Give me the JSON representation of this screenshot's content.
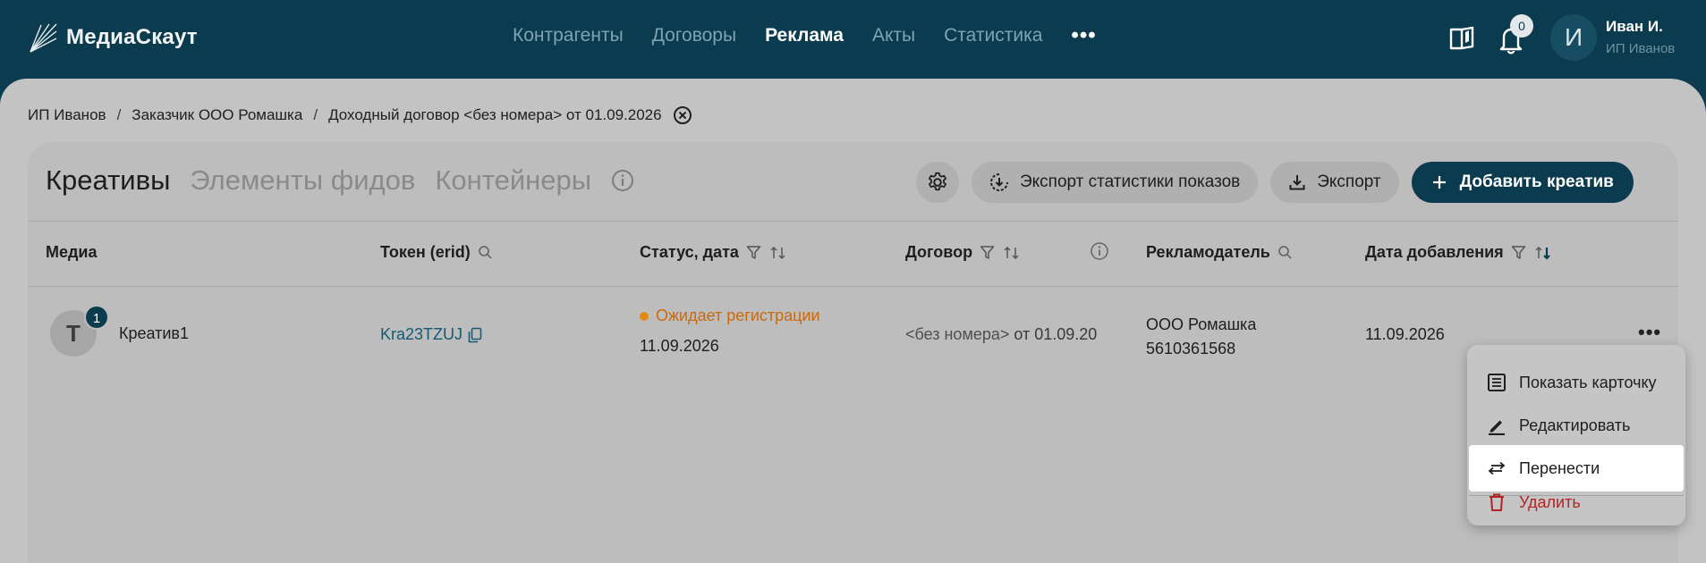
{
  "brand": {
    "name": "МедиаСкаут"
  },
  "nav": {
    "items": [
      {
        "label": "Контрагенты",
        "active": false
      },
      {
        "label": "Договоры",
        "active": false
      },
      {
        "label": "Реклама",
        "active": true
      },
      {
        "label": "Акты",
        "active": false
      },
      {
        "label": "Статистика",
        "active": false
      }
    ],
    "more_label": "•••"
  },
  "header": {
    "notifications_count": "0",
    "user_initial": "И",
    "user_name": "Иван И.",
    "user_org": "ИП Иванов"
  },
  "breadcrumb": {
    "items": [
      "ИП Иванов",
      "Заказчик ООО Ромашка",
      "Доходный договор <без номера> от 01.09.2026"
    ],
    "separator": "/"
  },
  "tabs": [
    {
      "label": "Креативы",
      "active": true
    },
    {
      "label": "Элементы фидов",
      "active": false
    },
    {
      "label": "Контейнеры",
      "active": false
    }
  ],
  "actions": {
    "export_stats_label": "Экспорт статистики показов",
    "export_label": "Экспорт",
    "add_label": "Добавить креатив"
  },
  "table": {
    "columns": [
      "Медиа",
      "Токен (erid)",
      "Статус, дата",
      "Договор",
      "Рекламодатель",
      "Дата добавления"
    ],
    "rows": [
      {
        "media_initial": "Т",
        "media_count": "1",
        "media_name": "Креатив1",
        "token": "Kra23TZUJ",
        "status": "Ожидает регистрации",
        "status_date": "11.09.2026",
        "contract_number": "<без номера>",
        "contract_date": "от 01.09.20",
        "advertiser_name": "ООО Ромашка",
        "advertiser_inn": "5610361568",
        "added_date": "11.09.2026",
        "more_label": "•••"
      }
    ]
  },
  "context_menu": {
    "items": [
      {
        "label": "Показать карточку",
        "icon": "card-list-icon"
      },
      {
        "label": "Редактировать",
        "icon": "pencil-icon"
      },
      {
        "label": "Перенести",
        "icon": "transfer-arrows-icon",
        "highlighted": true
      },
      {
        "label": "Удалить",
        "icon": "trash-icon",
        "danger": true
      }
    ]
  },
  "colors": {
    "brand_dark": "#0b3b4f",
    "status_pending": "#c96a0f",
    "danger": "#b32323",
    "link": "#135a72"
  }
}
